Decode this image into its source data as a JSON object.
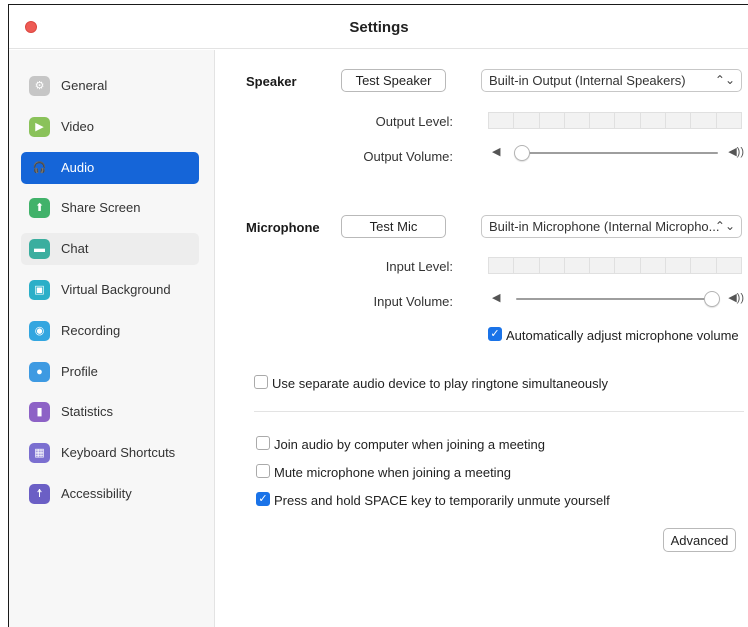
{
  "window": {
    "title": "Settings"
  },
  "colors": {
    "accent": "#1565d8",
    "close": "#ee5b55",
    "checkbox": "#1a73e8"
  },
  "sidebar": {
    "items": [
      {
        "label": "General",
        "icon": "gear-icon",
        "color": "#c6c6c6",
        "glyph": "⚙"
      },
      {
        "label": "Video",
        "icon": "video-camera-icon",
        "color": "#8ac25a",
        "glyph": "▶"
      },
      {
        "label": "Audio",
        "icon": "headphones-icon",
        "color": "#1565d8",
        "glyph": "🎧"
      },
      {
        "label": "Share Screen",
        "icon": "share-screen-icon",
        "color": "#41b26a",
        "glyph": "⬆"
      },
      {
        "label": "Chat",
        "icon": "chat-bubble-icon",
        "color": "#3bae9f",
        "glyph": "▬"
      },
      {
        "label": "Virtual Background",
        "icon": "virtual-background-icon",
        "color": "#2bafc8",
        "glyph": "▣"
      },
      {
        "label": "Recording",
        "icon": "recording-icon",
        "color": "#33a6e0",
        "glyph": "◉"
      },
      {
        "label": "Profile",
        "icon": "profile-icon",
        "color": "#3e9ae2",
        "glyph": "●"
      },
      {
        "label": "Statistics",
        "icon": "statistics-icon",
        "color": "#8d62c6",
        "glyph": "▮"
      },
      {
        "label": "Keyboard Shortcuts",
        "icon": "keyboard-icon",
        "color": "#7b6fd0",
        "glyph": "▦"
      },
      {
        "label": "Accessibility",
        "icon": "accessibility-icon",
        "color": "#6b5fc5",
        "glyph": "☨"
      }
    ],
    "active_index": 2,
    "hover_index": 4
  },
  "speaker": {
    "label": "Speaker",
    "test_button": "Test Speaker",
    "device": "Built-in Output (Internal Speakers)",
    "output_level_label": "Output Level:",
    "output_volume_label": "Output Volume:",
    "volume": 0.03
  },
  "microphone": {
    "label": "Microphone",
    "test_button": "Test Mic",
    "device": "Built-in Microphone (Internal Micropho...",
    "input_level_label": "Input Level:",
    "input_volume_label": "Input Volume:",
    "volume": 0.97,
    "auto_adjust": {
      "label": "Automatically adjust microphone volume",
      "checked": true
    }
  },
  "options": {
    "separate_ringtone": {
      "label": "Use separate audio device to play ringtone simultaneously",
      "checked": false
    },
    "join_audio": {
      "label": "Join audio by computer when joining a meeting",
      "checked": false
    },
    "mute_on_join": {
      "label": "Mute microphone when joining a meeting",
      "checked": false
    },
    "space_unmute": {
      "label": "Press and hold SPACE key to temporarily unmute yourself",
      "checked": true
    }
  },
  "advanced_button": "Advanced",
  "glyphs": {
    "select_chevron": "⌃⌄",
    "checkmark": "✓",
    "volume_low": "◀",
    "volume_high": "◀))"
  }
}
